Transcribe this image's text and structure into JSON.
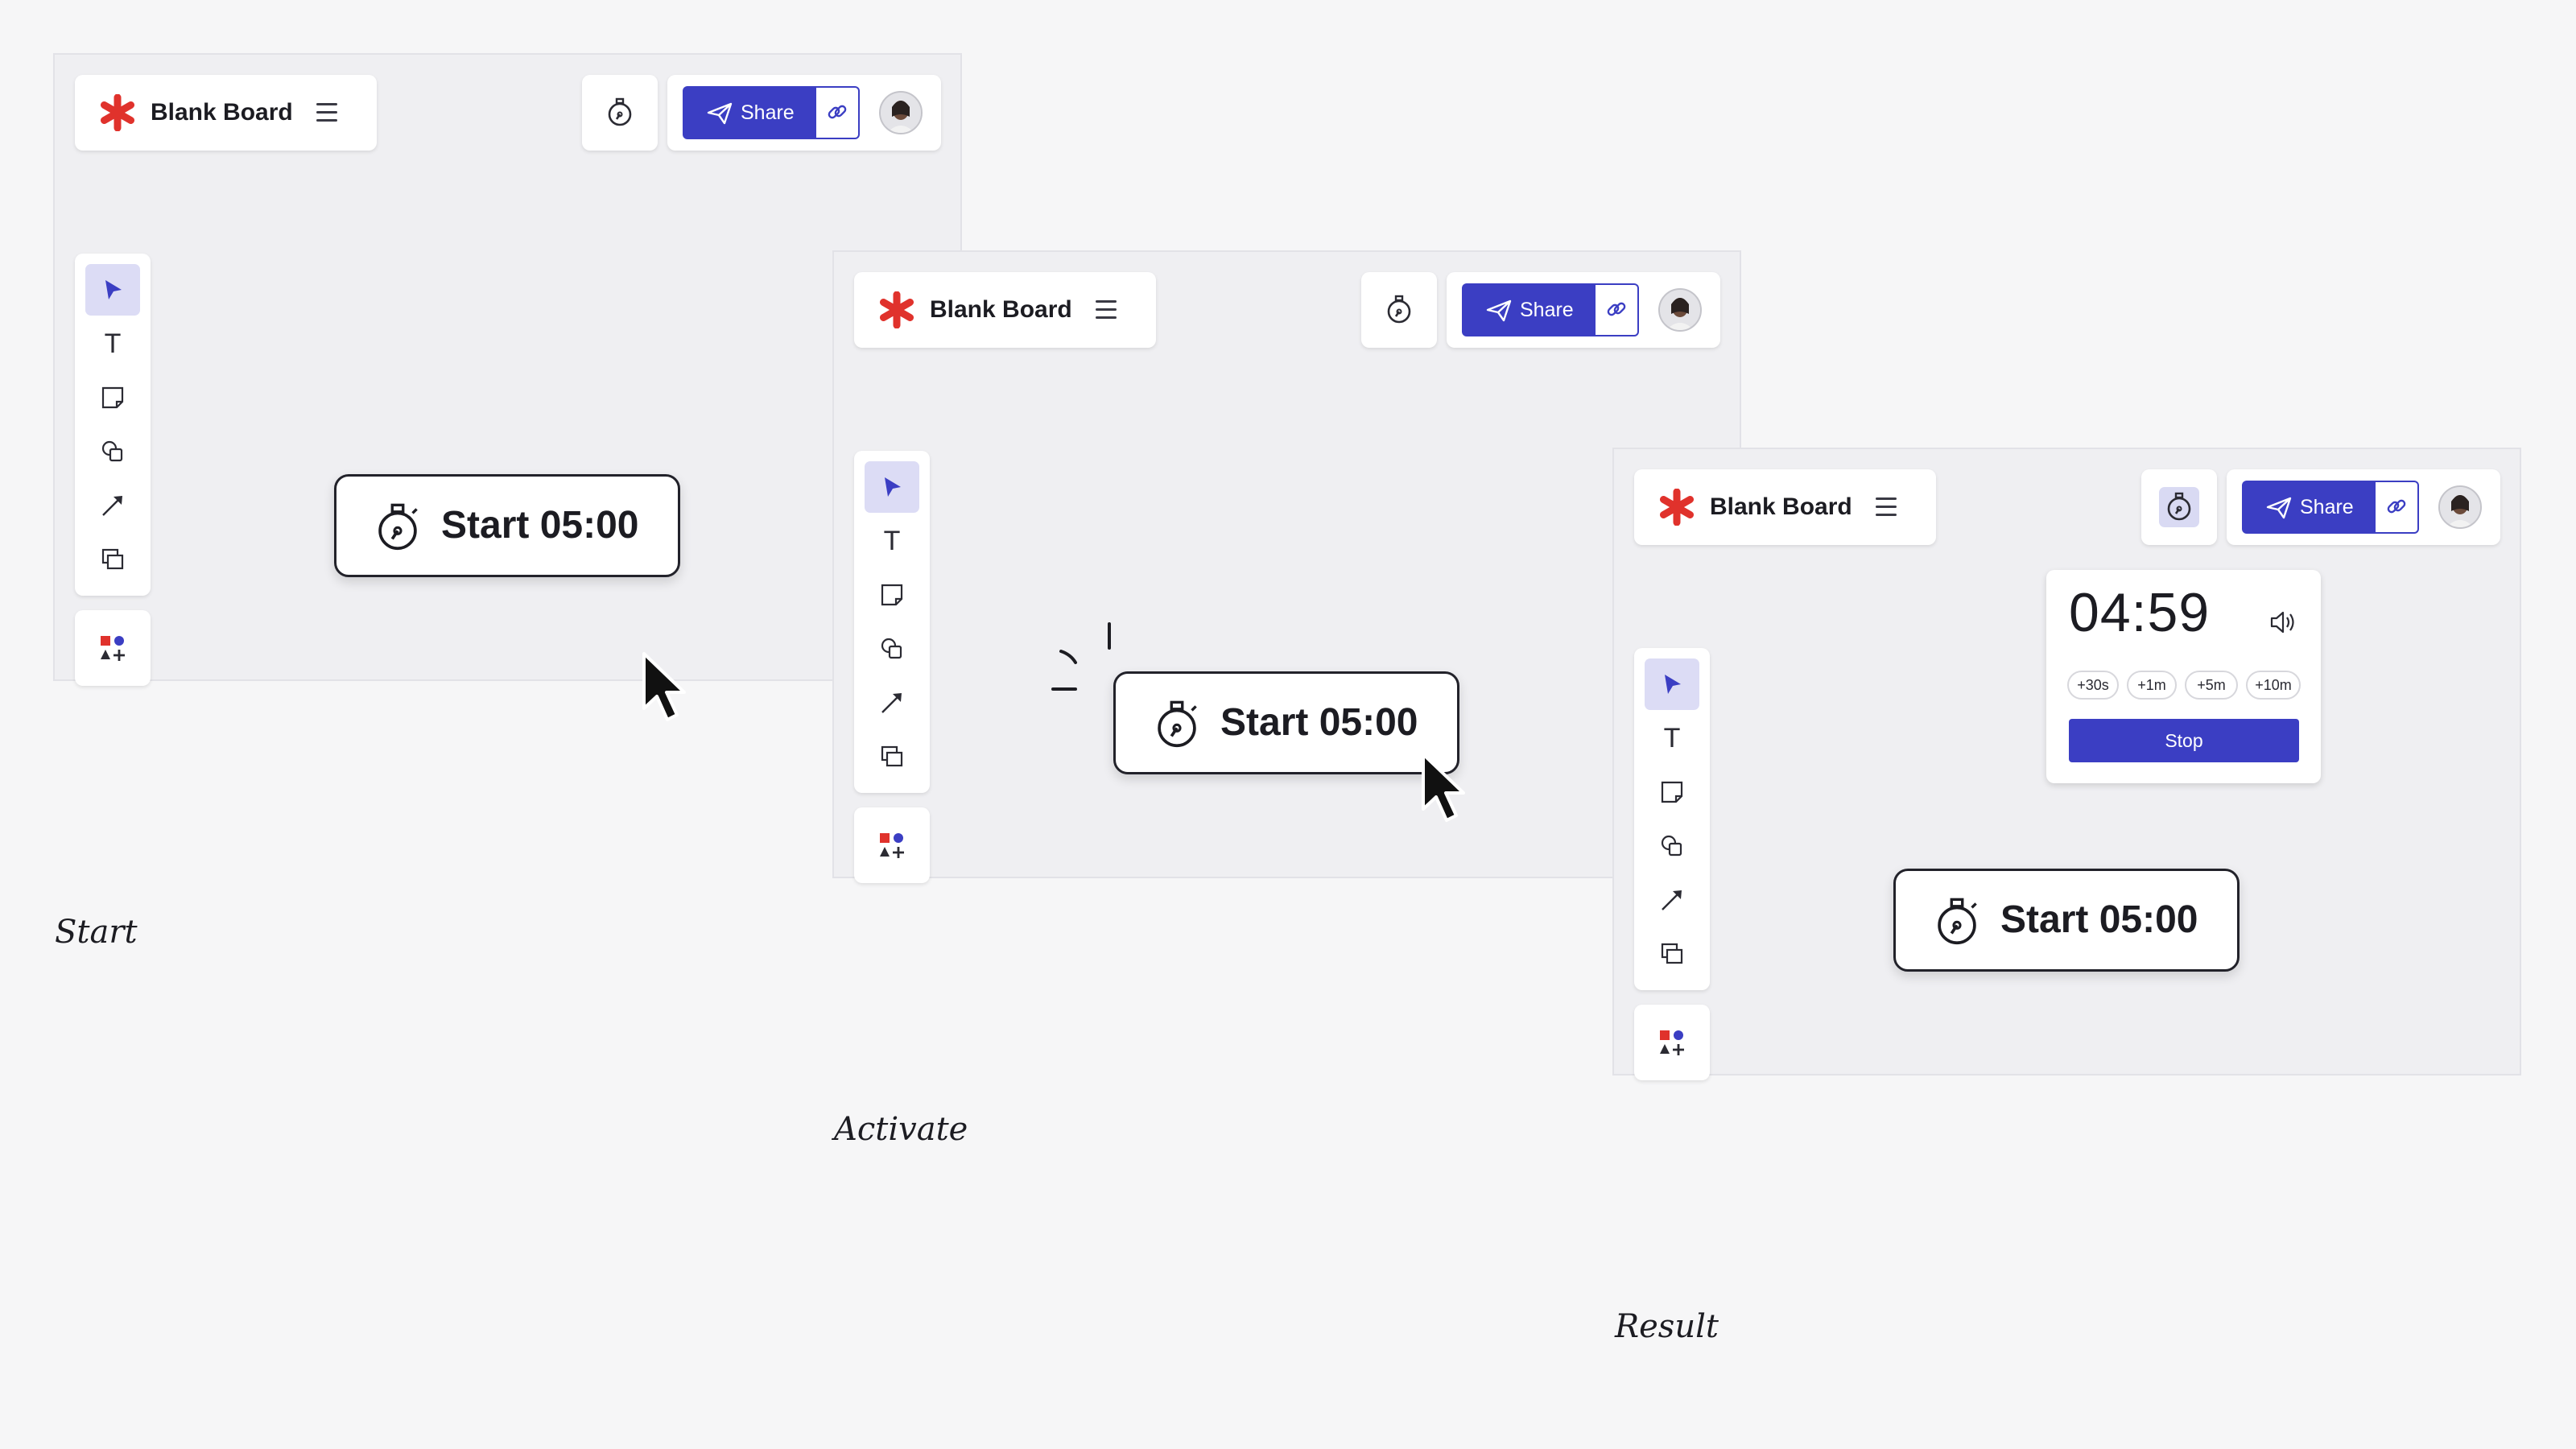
{
  "board": {
    "title": "Blank Board",
    "share_label": "Share",
    "start_button_label": "Start 05:00"
  },
  "timer_panel": {
    "time": "04:59",
    "increments": [
      "+30s",
      "+1m",
      "+5m",
      "+10m"
    ],
    "stop_label": "Stop"
  },
  "captions": {
    "start": "Start",
    "activate": "Activate",
    "result": "Result"
  },
  "colors": {
    "accent": "#3b3ec3",
    "logo": "#e0322c",
    "selected_tool_bg": "#dcdcf5"
  },
  "icons": [
    "asterisk-logo-icon",
    "menu-icon",
    "stopwatch-icon",
    "paper-plane-icon",
    "link-icon",
    "avatar",
    "pointer-icon",
    "text-icon",
    "sticky-note-icon",
    "shapes-icon",
    "arrow-icon",
    "frame-icon",
    "add-ons-icon",
    "volume-icon",
    "mouse-cursor-icon"
  ]
}
